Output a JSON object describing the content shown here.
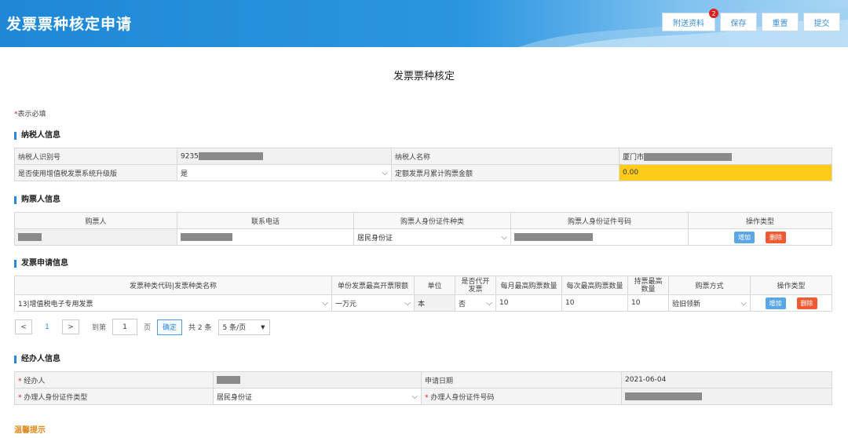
{
  "header": {
    "title": "发票票种核定申请",
    "buttons": {
      "attach": "附送资料",
      "attach_badge": "2",
      "save": "保存",
      "reset": "重置",
      "submit": "提交"
    }
  },
  "page_title": "发票票种核定",
  "required_note": {
    "star": "*",
    "text": "表示必填"
  },
  "taxpayer": {
    "section": "纳税人信息",
    "id_label": "纳税人识别号",
    "id_value": "9235",
    "name_label": "纳税人名称",
    "name_value": "厦门市",
    "upgrade_label": "是否使用增值税发票系统升级版",
    "upgrade_value": "是",
    "quota_label": "定额发票月累计购票金额",
    "quota_value": "0.00"
  },
  "buyer": {
    "section": "购票人信息",
    "headers": [
      "购票人",
      "联系电话",
      "购票人身份证件种类",
      "购票人身份证件号码",
      "操作类型"
    ],
    "id_type": "居民身份证",
    "add": "增加",
    "delete": "删除"
  },
  "apply": {
    "section": "发票申请信息",
    "headers": [
      "发票种类代码|发票种类名称",
      "单份发票最高开票限额",
      "单位",
      "是否代开发票",
      "每月最高购票数量",
      "每次最高购票数量",
      "持票最高数量",
      "购票方式",
      "操作类型"
    ],
    "row": {
      "type": "13|增值税电子专用发票",
      "limit": "一万元",
      "unit": "本",
      "agent": "否",
      "monthly": "10",
      "each": "10",
      "hold": "10",
      "method": "验旧领新"
    },
    "add": "增加",
    "delete": "删除"
  },
  "pager": {
    "prev": "<",
    "current": "1",
    "next": ">",
    "goto_label": "到第",
    "goto_value": "1",
    "page_label": "页",
    "confirm": "确定",
    "total": "共 2 条",
    "size": "5 条/页"
  },
  "agent": {
    "section": "经办人信息",
    "star": "*",
    "name_label": "经办人",
    "date_label": "申请日期",
    "date_value": "2021-06-04",
    "idtype_label": "办理人身份证件类型",
    "idtype_value": "居民身份证",
    "idno_label": "办理人身份证件号码"
  },
  "tip": "温馨提示",
  "colors": {
    "header": "#1e88d6",
    "accent": "#2a88d8",
    "highlight": "#ffcc1a",
    "danger": "#ef5a32",
    "tip": "#e08a1e"
  }
}
